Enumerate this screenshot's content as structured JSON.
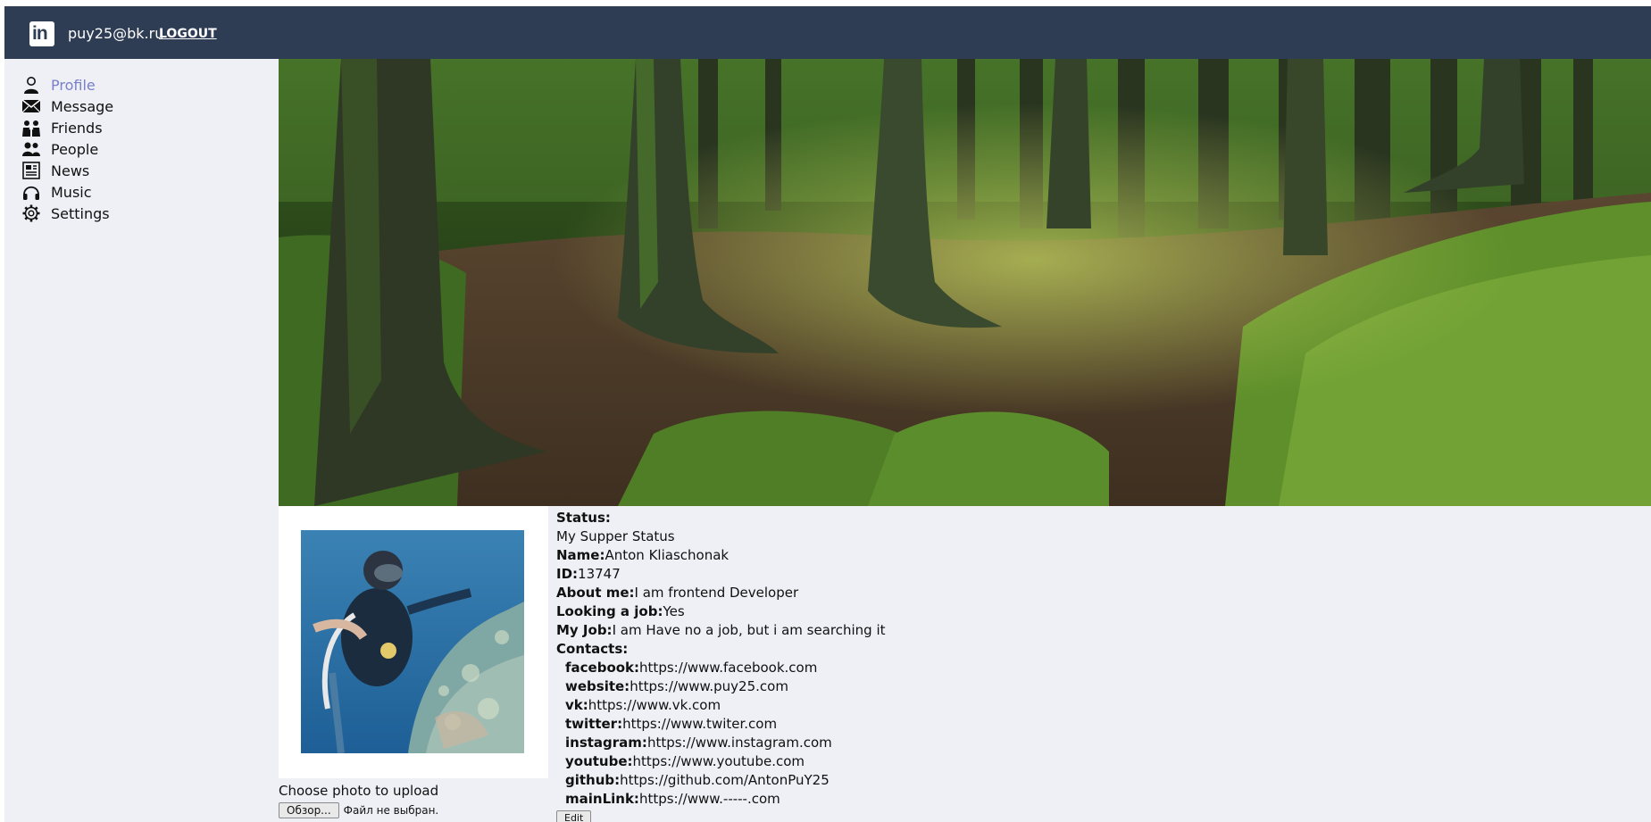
{
  "header": {
    "logo_text": "in",
    "email": "puy25@bk.ru",
    "logout_label": "LOGOUT"
  },
  "sidebar": {
    "items": [
      {
        "label": "Profile",
        "icon": "user-icon",
        "active": true
      },
      {
        "label": "Message",
        "icon": "envelope-icon",
        "active": false
      },
      {
        "label": "Friends",
        "icon": "friends-icon",
        "active": false
      },
      {
        "label": "People",
        "icon": "people-icon",
        "active": false
      },
      {
        "label": "News",
        "icon": "newspaper-icon",
        "active": false
      },
      {
        "label": "Music",
        "icon": "headphones-icon",
        "active": false
      },
      {
        "label": "Settings",
        "icon": "gear-icon",
        "active": false
      }
    ]
  },
  "banner": {
    "image": "forest-banner"
  },
  "avatar": {
    "image": "diver-photo"
  },
  "upload": {
    "label": "Choose photo to upload",
    "browse_label": "Обзор...",
    "file_status": "Файл не выбран."
  },
  "profile": {
    "status_label": "Status:",
    "status_value": "My Supper Status",
    "name_label": "Name:",
    "name_value": "Anton Kliaschonak",
    "id_label": "ID:",
    "id_value": "13747",
    "about_label": "About me:",
    "about_value": "I am frontend Developer",
    "looking_label": "Looking a job:",
    "looking_value": "Yes",
    "job_label": "My Job:",
    "job_value": "I am Have no a job, but i am searching it",
    "contacts_label": "Contacts:",
    "contacts": [
      {
        "key": "facebook:",
        "value": "https://www.facebook.com"
      },
      {
        "key": "website:",
        "value": "https://www.puy25.com"
      },
      {
        "key": "vk:",
        "value": "https://www.vk.com"
      },
      {
        "key": "twitter:",
        "value": "https://www.twiter.com"
      },
      {
        "key": "instagram:",
        "value": "https://www.instagram.com"
      },
      {
        "key": "youtube:",
        "value": "https://www.youtube.com"
      },
      {
        "key": "github:",
        "value": "https://github.com/AntonPuY25"
      },
      {
        "key": "mainLink:",
        "value": "https://www.-----.com"
      }
    ],
    "edit_label": "Edit"
  },
  "colors": {
    "header_bg": "#2f3d54",
    "page_bg": "#eef0f6",
    "active_nav": "#7a7fc8"
  }
}
